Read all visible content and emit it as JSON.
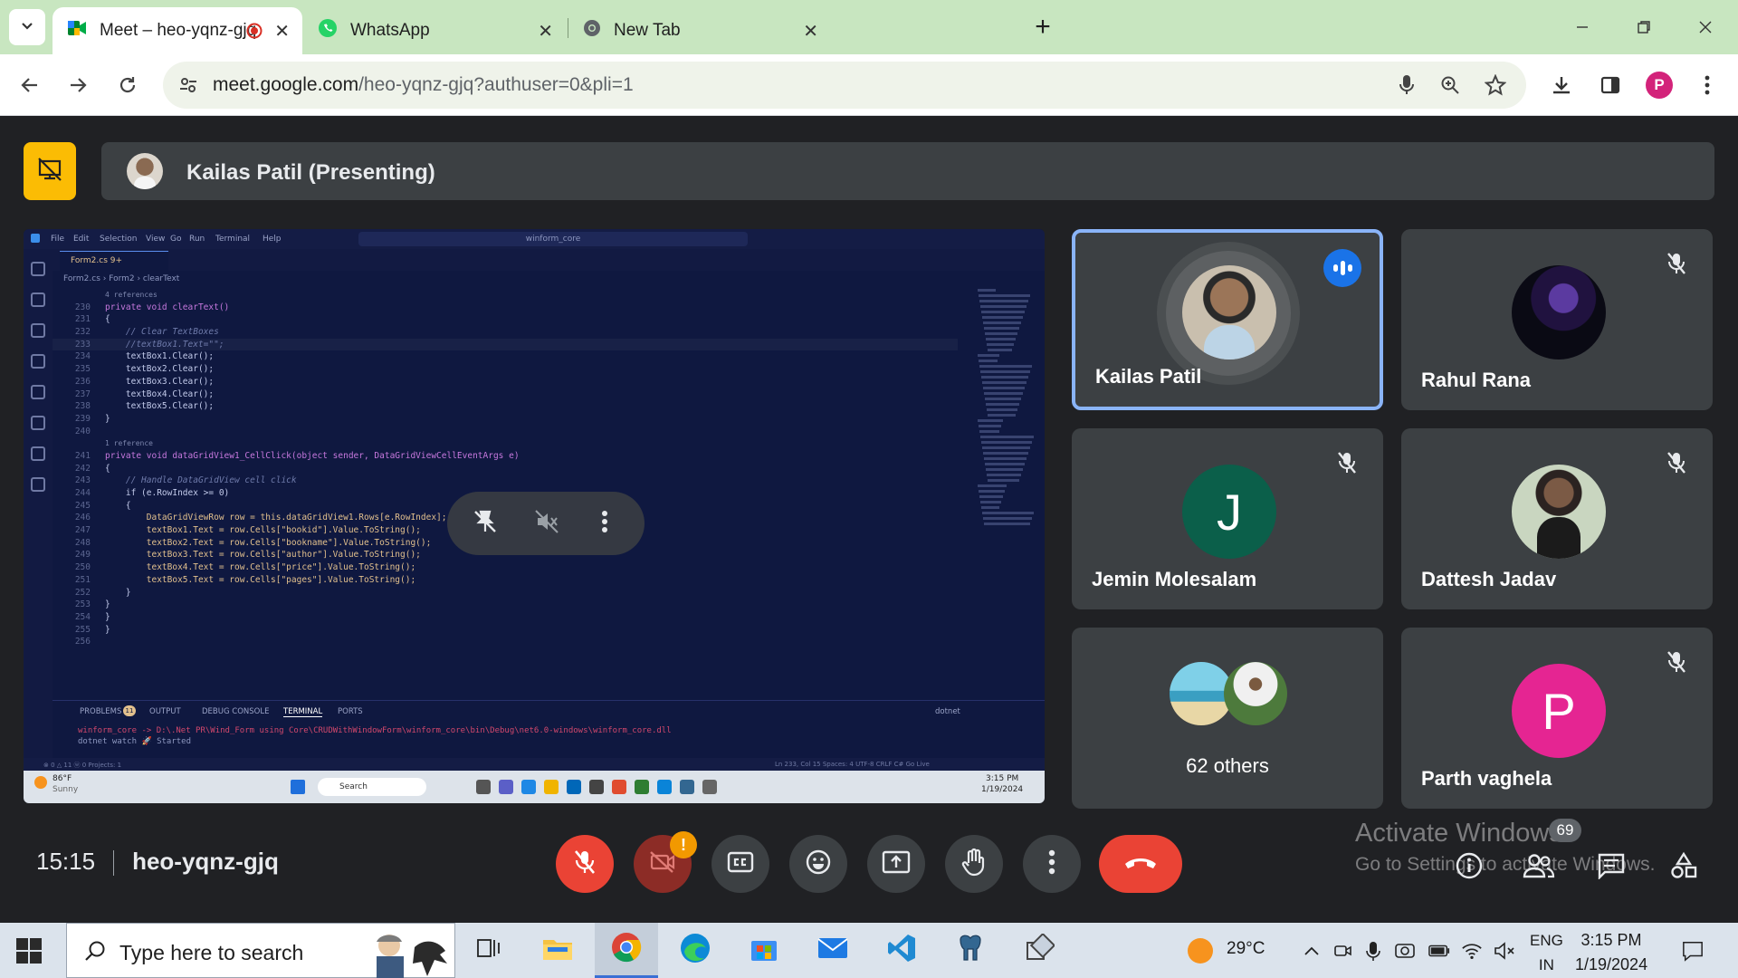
{
  "browser": {
    "tabs": [
      {
        "title": "Meet – heo-yqnz-gjq",
        "icon": "google-meet-icon",
        "recording": true
      },
      {
        "title": "WhatsApp",
        "icon": "whatsapp-icon"
      },
      {
        "title": "New Tab",
        "icon": "chrome-icon"
      }
    ],
    "url_host": "meet.google.com",
    "url_path": "/heo-yqnz-gjq?authuser=0&pli=1",
    "profile_initial": "P"
  },
  "meet": {
    "presenter_label": "Kailas Patil (Presenting)",
    "participants": [
      {
        "name": "Kailas Patil",
        "speaking": true
      },
      {
        "name": "Rahul Rana",
        "muted": true
      },
      {
        "name": "Jemin Molesalam",
        "initial": "J",
        "muted": true,
        "color": "#0b5f4a"
      },
      {
        "name": "Dattesh Jadav",
        "muted": true
      },
      {
        "name": "62 others"
      },
      {
        "name": "Parth vaghela",
        "initial": "P",
        "muted": true,
        "color": "#e52592"
      }
    ],
    "time": "15:15",
    "meeting_code": "heo-yqnz-gjq",
    "people_count": "69",
    "watermark_line1": "Activate Windows",
    "watermark_line2": "Go to Settings to activate Windows."
  },
  "shared_screen": {
    "menu": [
      "File",
      "Edit",
      "Selection",
      "View",
      "Go",
      "Run",
      "Terminal",
      "Help"
    ],
    "command_center": "winform_core",
    "file_tab": "Form2.cs 9+",
    "breadcrumb": "Form2.cs › Form2 › clearText",
    "code_lines": [
      {
        "n": "",
        "t": "4 references"
      },
      {
        "n": "230",
        "t": "private void clearText()"
      },
      {
        "n": "231",
        "t": "{"
      },
      {
        "n": "232",
        "t": "    // Clear TextBoxes"
      },
      {
        "n": "233",
        "t": "    //textBox1.Text=\"\";"
      },
      {
        "n": "234",
        "t": "    textBox1.Clear();"
      },
      {
        "n": "235",
        "t": "    textBox2.Clear();"
      },
      {
        "n": "236",
        "t": "    textBox3.Clear();"
      },
      {
        "n": "237",
        "t": "    textBox4.Clear();"
      },
      {
        "n": "238",
        "t": "    textBox5.Clear();"
      },
      {
        "n": "239",
        "t": "}"
      },
      {
        "n": "240",
        "t": ""
      },
      {
        "n": "",
        "t": "1 reference"
      },
      {
        "n": "241",
        "t": "private void dataGridView1_CellClick(object sender, DataGridViewCellEventArgs e)"
      },
      {
        "n": "242",
        "t": "{"
      },
      {
        "n": "243",
        "t": "    // Handle DataGridView cell click"
      },
      {
        "n": "244",
        "t": "    if (e.RowIndex >= 0)"
      },
      {
        "n": "245",
        "t": "    {"
      },
      {
        "n": "246",
        "t": "        DataGridViewRow row = this.dataGridView1.Rows[e.RowIndex];"
      },
      {
        "n": "247",
        "t": "        textBox1.Text = row.Cells[\"bookid\"].Value.ToString();"
      },
      {
        "n": "248",
        "t": "        textBox2.Text = row.Cells[\"bookname\"].Value.ToString();"
      },
      {
        "n": "249",
        "t": "        textBox3.Text = row.Cells[\"author\"].Value.ToString();"
      },
      {
        "n": "250",
        "t": "        textBox4.Text = row.Cells[\"price\"].Value.ToString();"
      },
      {
        "n": "251",
        "t": "        textBox5.Text = row.Cells[\"pages\"].Value.ToString();"
      },
      {
        "n": "252",
        "t": "    }"
      },
      {
        "n": "253",
        "t": "}"
      },
      {
        "n": "254",
        "t": "}"
      },
      {
        "n": "255",
        "t": "}"
      },
      {
        "n": "256",
        "t": ""
      }
    ],
    "panel_tabs": [
      "PROBLEMS",
      "OUTPUT",
      "DEBUG CONSOLE",
      "TERMINAL",
      "PORTS"
    ],
    "problems_count": "11",
    "terminal_name": "dotnet",
    "terminal_line1": "winform_core -> D:\\.Net PR\\Wind_Form using Core\\CRUDWithWindowForm\\winform_core\\bin\\Debug\\net6.0-windows\\winform_core.dll",
    "terminal_line2": "dotnet watch 🚀 Started",
    "status_left": "⊗ 0 △ 11   ⓦ 0   Projects: 1",
    "status_right": "Ln 233, Col 15   Spaces: 4   UTF-8   CRLF   C#   Go Live",
    "weather_temp": "86°F",
    "weather_text": "Sunny",
    "search_text": "Search",
    "time": "3:15 PM",
    "date": "1/19/2024"
  },
  "taskbar": {
    "search_placeholder": "Type here to search",
    "temperature": "29°C",
    "lang_line1": "ENG",
    "lang_line2": "IN",
    "time": "3:15 PM",
    "date": "1/19/2024"
  }
}
